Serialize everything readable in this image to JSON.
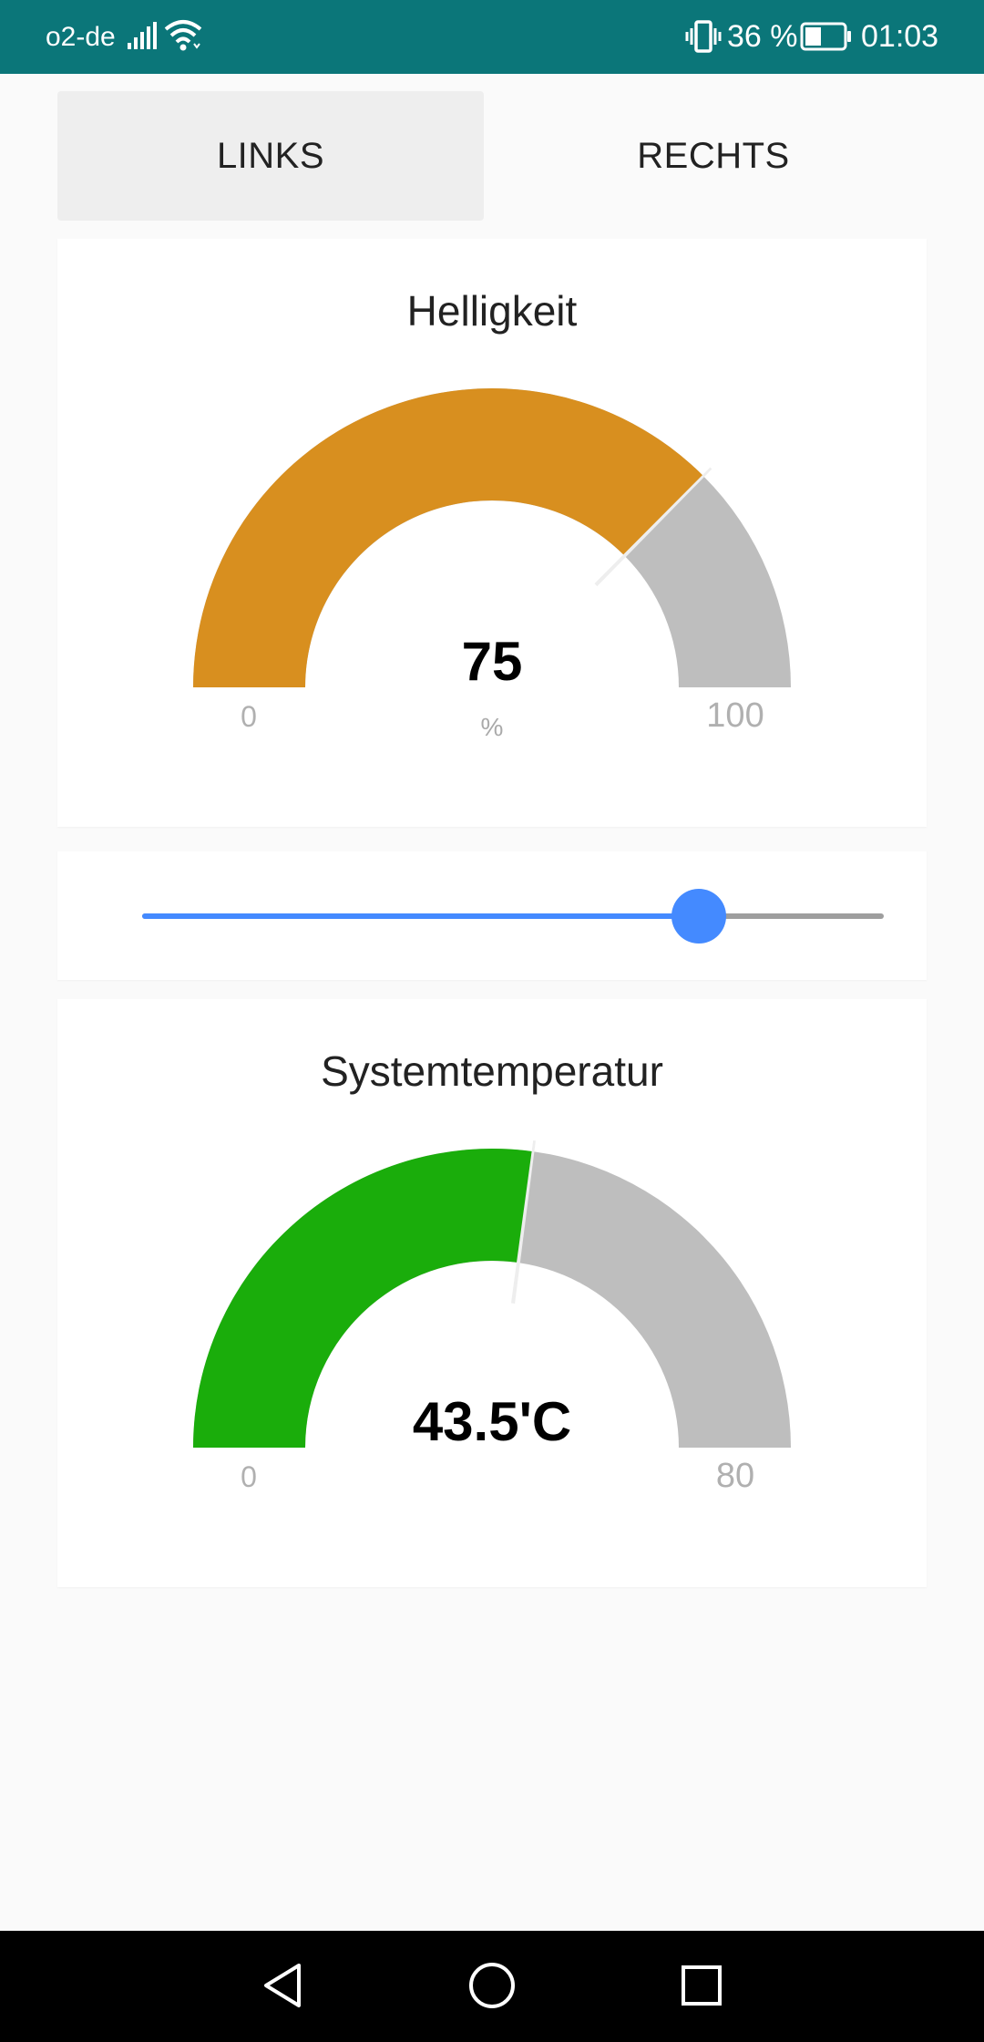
{
  "status_bar": {
    "carrier": "o2-de",
    "battery_percent": "36 %",
    "time": "01:03",
    "icons": [
      "signal-icon",
      "wifi-icon",
      "vibrate-icon",
      "battery-icon"
    ],
    "background": "#0b7679"
  },
  "tabs": [
    {
      "label": "LINKS",
      "selected": true
    },
    {
      "label": "RECHTS",
      "selected": false
    }
  ],
  "gauges": {
    "brightness": {
      "title": "Helligkeit",
      "value": 75,
      "value_display": "75",
      "unit": "%",
      "min": 0,
      "max": 100,
      "min_label": "0",
      "max_label": "100",
      "color": "#d88f1f",
      "track_color": "#bebebe"
    },
    "temperature": {
      "title": "Systemtemperatur",
      "value": 43.5,
      "value_display": "43.5'C",
      "min": 0,
      "max": 80,
      "min_label": "0",
      "max_label": "80",
      "color": "#1aad0b",
      "track_color": "#bebebe"
    }
  },
  "slider": {
    "value": 75,
    "min": 0,
    "max": 100,
    "color": "#448aff",
    "track_color": "#9e9e9e"
  },
  "nav_bar": {
    "icons": [
      "back-icon",
      "home-icon",
      "recents-icon"
    ]
  }
}
